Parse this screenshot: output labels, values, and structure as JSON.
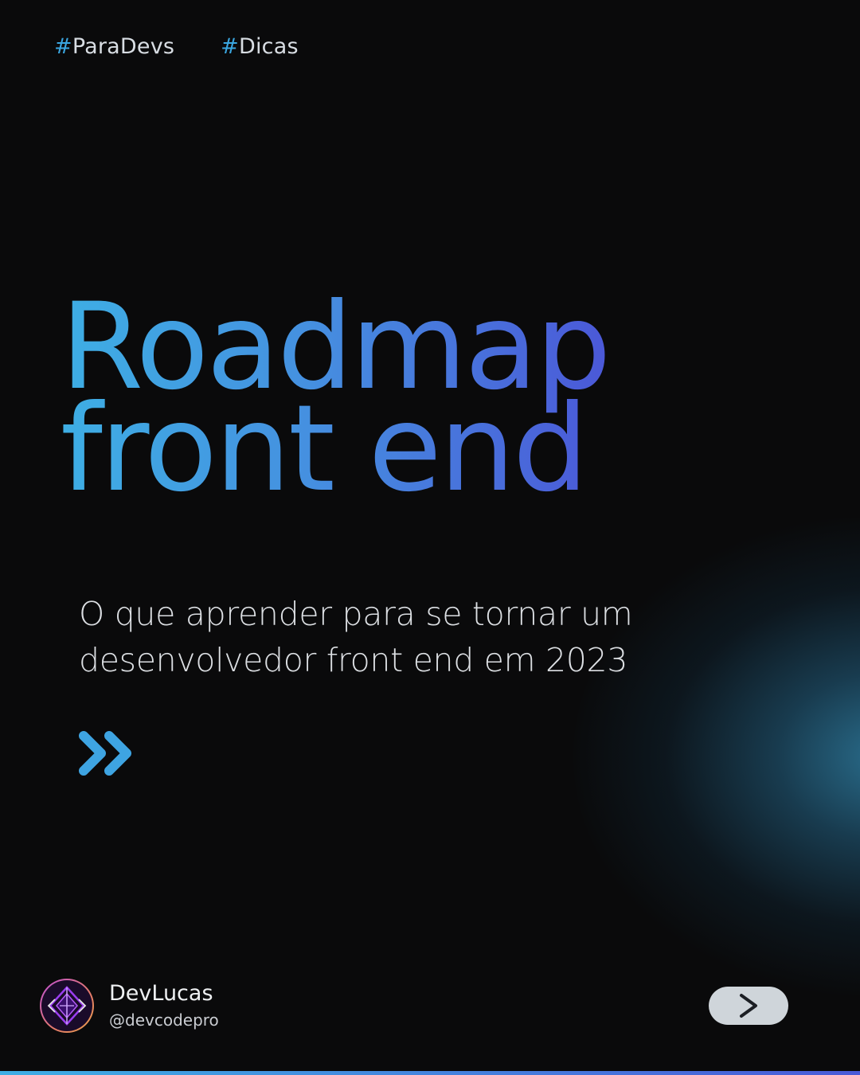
{
  "tags": [
    {
      "hash": "#",
      "label": "ParaDevs"
    },
    {
      "hash": "#",
      "label": "Dicas"
    }
  ],
  "title": {
    "line1": "Roadmap",
    "line2": "front end"
  },
  "subtitle": "O que aprender para se tornar um desenvolvedor front end em 2023",
  "profile": {
    "name": "DevLucas",
    "handle": "@devcodepro"
  },
  "icons": {
    "chevrons": "double-chevron-right-icon",
    "avatar_logo": "diamond-logo-icon",
    "next": "chevron-right-icon"
  },
  "colors": {
    "background": "#0a0a0b",
    "accent_start": "#3eaee4",
    "accent_end": "#4b58d8",
    "glow": "#3184aa",
    "button": "#cfd5da"
  }
}
